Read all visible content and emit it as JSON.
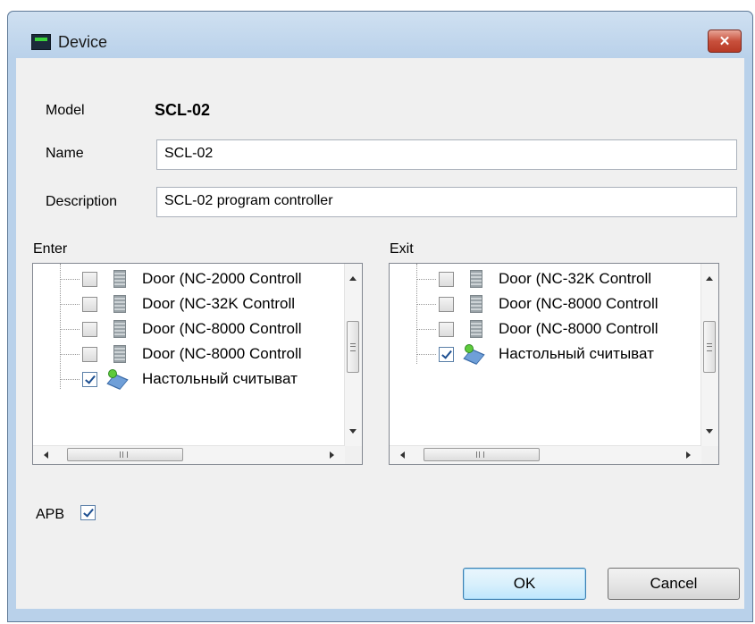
{
  "window": {
    "title": "Device",
    "close_glyph": "✕",
    "icon": "device-app-icon"
  },
  "form": {
    "model_label": "Model",
    "model_value": "SCL-02",
    "name_label": "Name",
    "name_value": "SCL-02",
    "description_label": "Description",
    "description_value": "SCL-02 program controller"
  },
  "enter": {
    "label": "Enter",
    "items": [
      {
        "text": "Door (NC-2000 Controll",
        "checked": false,
        "icon": "door-icon"
      },
      {
        "text": "Door (NC-32K Controll",
        "checked": false,
        "icon": "door-icon"
      },
      {
        "text": "Door (NC-8000 Controll",
        "checked": false,
        "icon": "door-icon"
      },
      {
        "text": "Door (NC-8000 Controll",
        "checked": false,
        "icon": "door-icon"
      },
      {
        "text": "Настольный считыват",
        "checked": true,
        "icon": "desk-reader-icon"
      }
    ]
  },
  "exit": {
    "label": "Exit",
    "items": [
      {
        "text": "Door (NC-32K Controll",
        "checked": false,
        "icon": "door-icon"
      },
      {
        "text": "Door (NC-8000 Controll",
        "checked": false,
        "icon": "door-icon"
      },
      {
        "text": "Door (NC-8000 Controll",
        "checked": false,
        "icon": "door-icon"
      },
      {
        "text": "Настольный считыват",
        "checked": true,
        "icon": "desk-reader-icon"
      }
    ]
  },
  "apb": {
    "label": "APB",
    "checked": true
  },
  "buttons": {
    "ok": "OK",
    "cancel": "Cancel"
  },
  "colors": {
    "window_frame": "#b9d1ea",
    "client_bg": "#f0f0f0",
    "close_button": "#c8503c",
    "default_button": "#3c7fb1"
  }
}
